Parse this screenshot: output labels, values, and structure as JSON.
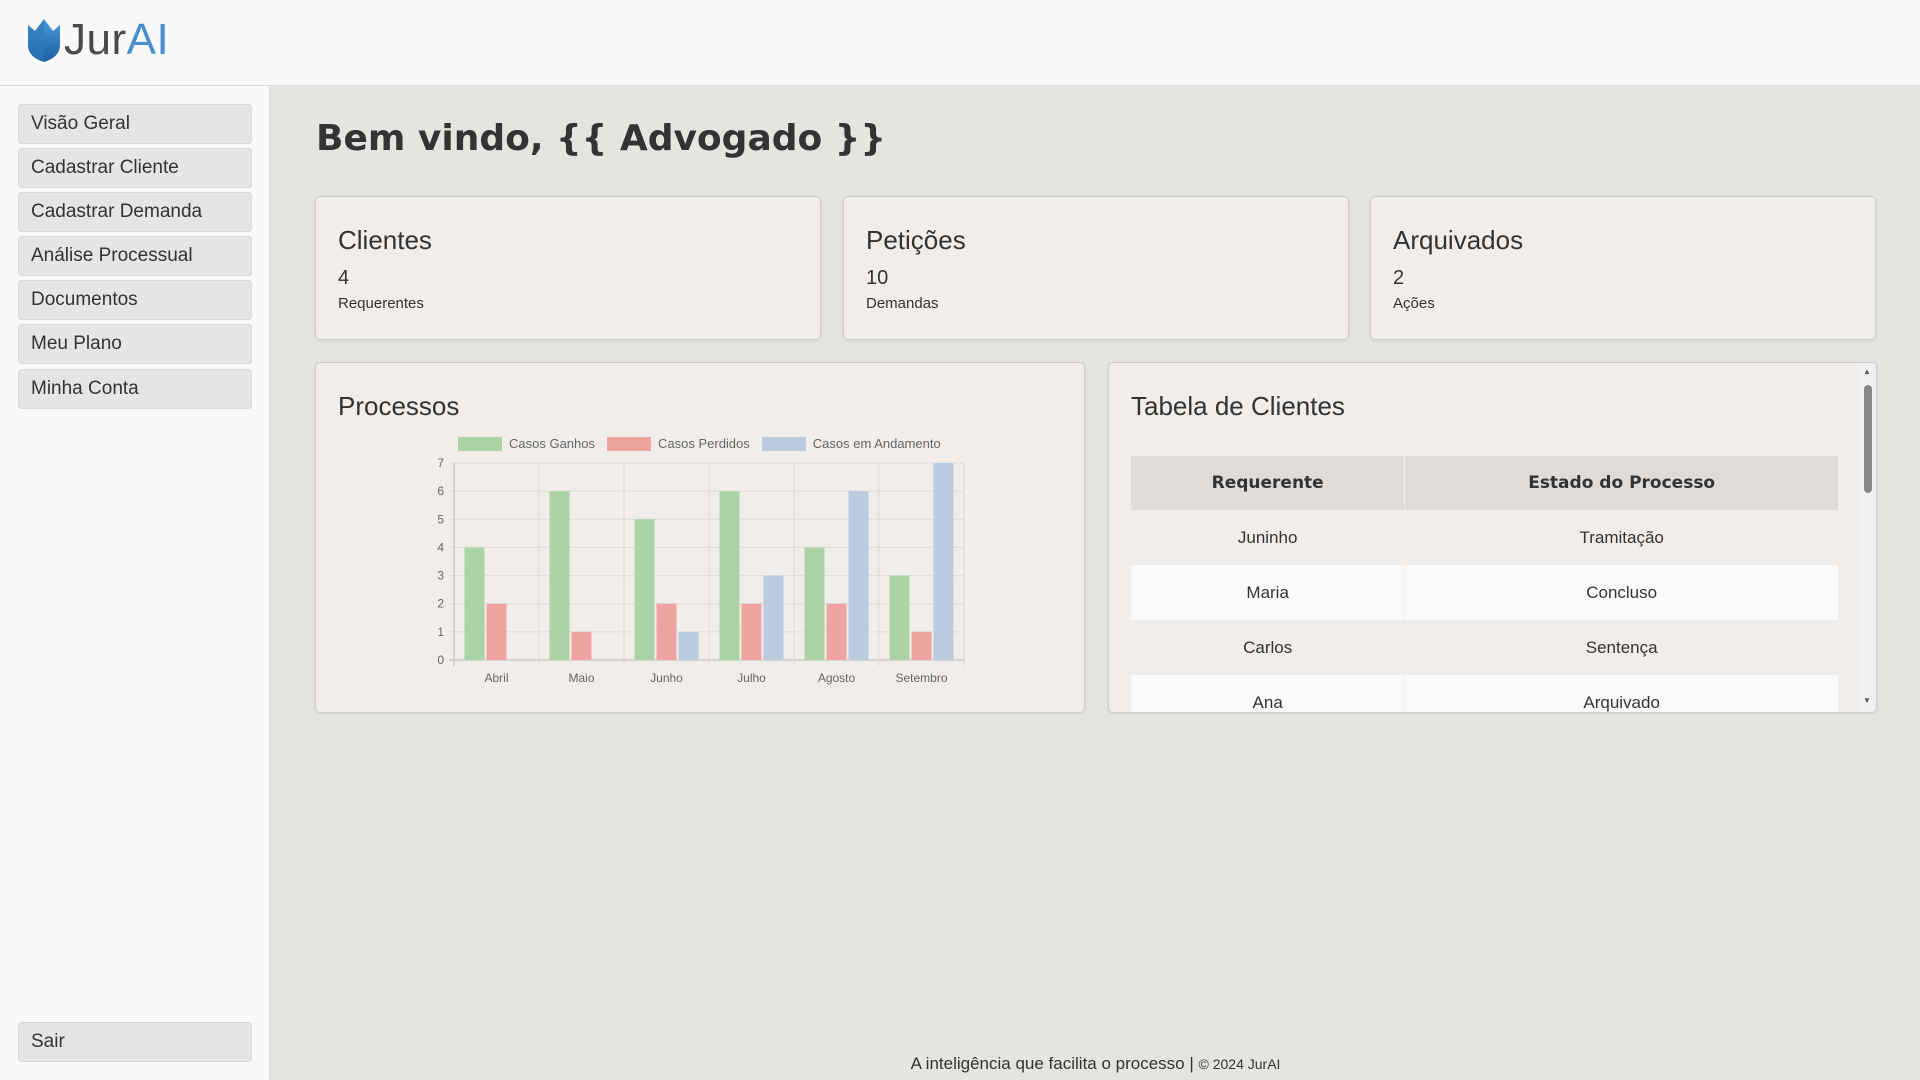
{
  "app": {
    "logo_jur": "Jur",
    "logo_ai": "AI"
  },
  "sidebar": {
    "items": [
      {
        "label": "Visão Geral"
      },
      {
        "label": "Cadastrar Cliente"
      },
      {
        "label": "Cadastrar Demanda"
      },
      {
        "label": "Análise Processual"
      },
      {
        "label": "Documentos"
      },
      {
        "label": "Meu Plano"
      },
      {
        "label": "Minha Conta"
      }
    ],
    "logout": "Sair"
  },
  "main": {
    "welcome": "Bem vindo, {{ Advogado }}",
    "stats": [
      {
        "title": "Clientes",
        "value": "4",
        "sub": "Requerentes"
      },
      {
        "title": "Petições",
        "value": "10",
        "sub": "Demandas"
      },
      {
        "title": "Arquivados",
        "value": "2",
        "sub": "Ações"
      }
    ],
    "chart_panel_title": "Processos",
    "table_panel": {
      "title": "Tabela de Clientes",
      "headers": [
        "Requerente",
        "Estado do Processo"
      ],
      "rows": [
        [
          "Juninho",
          "Tramitação"
        ],
        [
          "Maria",
          "Concluso"
        ],
        [
          "Carlos",
          "Sentença"
        ],
        [
          "Ana",
          "Arquivado"
        ]
      ]
    }
  },
  "footer": {
    "tagline": "A inteligência que facilita o processo |",
    "copyright": "© 2024 JurAI"
  },
  "chart_data": {
    "type": "bar",
    "categories": [
      "Abril",
      "Maio",
      "Junho",
      "Julho",
      "Agosto",
      "Setembro"
    ],
    "series": [
      {
        "name": "Casos Ganhos",
        "values": [
          4,
          6,
          5,
          6,
          4,
          3
        ],
        "color": "#abd3a4"
      },
      {
        "name": "Casos Perdidos",
        "values": [
          2,
          1,
          2,
          2,
          2,
          1
        ],
        "color": "#efa4a0"
      },
      {
        "name": "Casos em Andamento",
        "values": [
          0,
          0,
          1,
          3,
          6,
          7
        ],
        "color": "#bccce0"
      }
    ],
    "ylim": [
      0,
      7
    ],
    "yticks": [
      "0",
      "1",
      "2",
      "3",
      "4",
      "5",
      "6",
      "7"
    ],
    "grid": true,
    "legend": "top"
  }
}
